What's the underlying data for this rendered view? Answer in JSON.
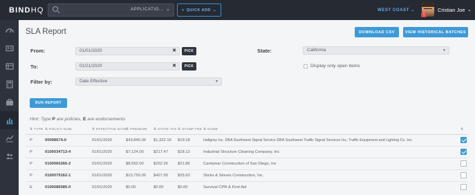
{
  "header": {
    "logo_bold": "BIND",
    "logo_light": "HQ",
    "search_scope": "APPLICATIO...",
    "quick_add": "QUICK ADD",
    "region": "WEST COAST",
    "notification_count": "1",
    "user_name": "Cristian Joe"
  },
  "sidenav": {
    "items": [
      "dashboard",
      "id-card",
      "table",
      "calculator",
      "briefcase",
      "reports",
      "trend",
      "users"
    ],
    "active": "reports"
  },
  "page": {
    "title": "SLA Report",
    "download_csv": "DOWNLOAD CSV",
    "view_history": "VIEW HISTORICAL BATCHES"
  },
  "form": {
    "from_label": "From:",
    "from_value": "01/01/2020",
    "to_label": "To:",
    "to_value": "01/21/2020",
    "pick_label": "PICK",
    "filter_label": "Filter by:",
    "filter_value": "Date Effective",
    "state_label": "State:",
    "state_value": "California",
    "open_items_label": "Display only open items",
    "open_items_checked": false,
    "run_report": "RUN REPORT"
  },
  "hint": {
    "prefix": "Hint: Type",
    "p": "P",
    "middle": "are policies,",
    "e": "E",
    "suffix": "are endorsements"
  },
  "table": {
    "headers": [
      "⇅ TYPE",
      "⇅ POLICY NUM",
      "⇅ EFFECTIVE DATE",
      "⇅ PREMIUM",
      "⇅ STATE TAX",
      "⇅ STAMP FEE",
      "⇅ NAME",
      "⇅"
    ],
    "rows": [
      {
        "type": "P",
        "policy": "00098674-0",
        "date": "01/01/2020",
        "premium": "$43,845.00",
        "tax": "$1,322.16",
        "fee": "$19.18",
        "name": "Hallgrey Inc. DBA Southwest Signal Service DBA Southwest Traffic Signal Services Inc, Traffic Equipment and Lighting Co. Inc.",
        "checked": true
      },
      {
        "type": "P",
        "policy": "0100034713-4",
        "date": "01/01/2020",
        "premium": "$7,124.00",
        "tax": "$217.47",
        "fee": "$18.12",
        "name": "Industrial Structure Cleaning Company, Inc",
        "checked": true
      },
      {
        "type": "P",
        "policy": "0100060266-2",
        "date": "01/01/2020",
        "premium": "$8,592.00",
        "tax": "$262.26",
        "fee": "$21.86",
        "name": "Cantamar Construction of San Diego, Inc",
        "checked": false
      },
      {
        "type": "P",
        "policy": "0100079162-1",
        "date": "01/01/2020",
        "premium": "$13,750.00",
        "tax": "$427.50",
        "fee": "$35.63",
        "name": "Sticks & Stones Construction, Inc.",
        "checked": false
      },
      {
        "type": "E",
        "policy": "0100086585-0",
        "date": "01/01/2020",
        "premium": "$0.00",
        "tax": "$0.00",
        "fee": "$0.00",
        "name": "Survival CPR & First Aid",
        "checked": false
      }
    ]
  }
}
